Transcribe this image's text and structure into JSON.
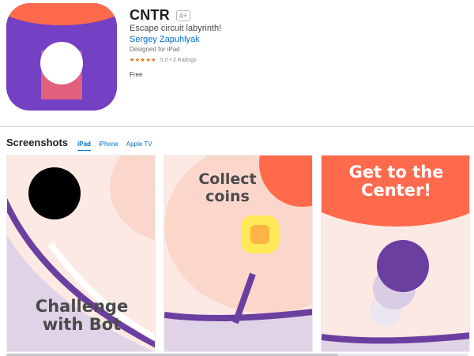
{
  "app": {
    "title": "CNTR",
    "age_rating": "4+",
    "subtitle": "Escape circuit labyrinth!",
    "developer": "Sergey Zapuhlyak",
    "designed_for": "Designed for iPad",
    "stars": "★★★★★",
    "rating_value": 5.0,
    "rating_text": "5.0 • 2 Ratings",
    "price": "Free"
  },
  "screenshots": {
    "title": "Screenshots",
    "tabs": [
      {
        "label": "iPad",
        "active": true
      },
      {
        "label": "iPhone",
        "active": false
      },
      {
        "label": "Apple TV",
        "active": false
      }
    ],
    "captions": [
      "Challenge\nwith Bot",
      "Collect\ncoins",
      "Get to the\nCenter!"
    ]
  },
  "colors": {
    "accent_link": "#0070c9",
    "icon_purple": "#6d3fbf",
    "icon_orange": "#ff6a4d",
    "game_bg": "#fde9e4",
    "game_purple": "#6b3fa0",
    "coin_yellow": "#ffe957"
  }
}
